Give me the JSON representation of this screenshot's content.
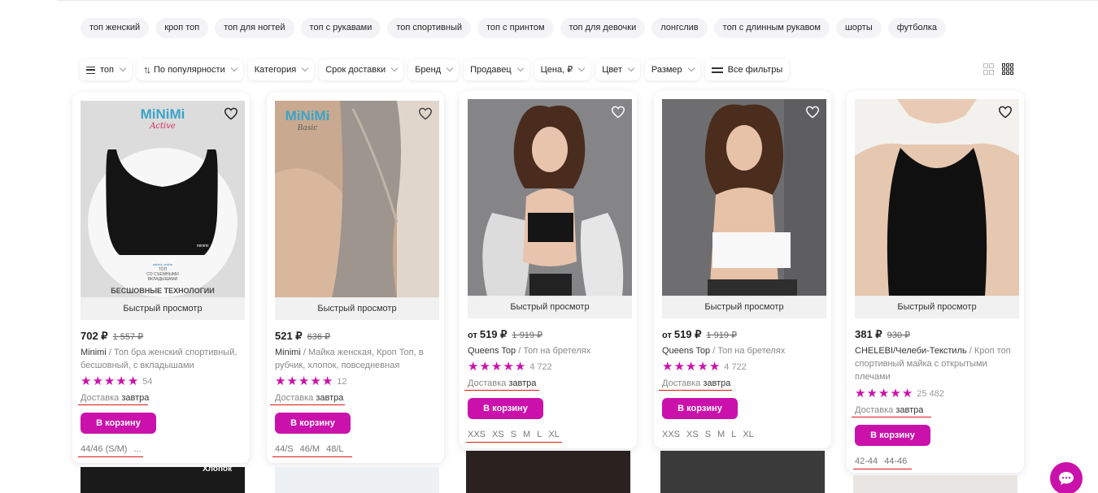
{
  "chips": [
    "топ женский",
    "кроп топ",
    "топ для ногтей",
    "топ с рукавами",
    "топ спортивный",
    "топ с принтом",
    "топ для девочки",
    "лонгслив",
    "топ с длинным рукавом",
    "шорты",
    "футболка"
  ],
  "filters": {
    "category_path": "топ",
    "sort": "По популярности",
    "items": [
      "Категория",
      "Срок доставки",
      "Бренд",
      "Продавец",
      "Цена, ₽",
      "Цвет",
      "Размер"
    ],
    "all_filters": "Все фильтры"
  },
  "common": {
    "quick_view": "Быстрый просмотр",
    "add_to_cart": "В корзину",
    "delivery_label": "Доставка",
    "delivery_value": "завтра",
    "from": "от",
    "sep": "/"
  },
  "products": [
    {
      "price": "702 ₽",
      "old_price": "1 557 ₽",
      "from": false,
      "brand": "Minimi",
      "name": "Топ бра женский спортивный, бесшовный, с вкладышами",
      "rating_count": "54",
      "sizes": [
        "44/46 (S/M)",
        "..."
      ],
      "image_text": {
        "logo": "MiNiMi",
        "sub": "Active",
        "label": "БЕСШОВНЫЕ ТЕХНОЛОГИИ",
        "tag_line1": "minimi_active",
        "tag_line2": "ТОП",
        "tag_line3": "СО СЪЕМНЫМИ",
        "tag_line4": "ВКЛАДЫШАМИ",
        "tag": "minimi"
      }
    },
    {
      "price": "521 ₽",
      "old_price": "636 ₽",
      "from": false,
      "brand": "Minimi",
      "name": "Майка женская, Кроп Топ, в рубчик, хлопок, повседневная",
      "rating_count": "12",
      "sizes": [
        "44/S",
        "46/M",
        "48/L"
      ],
      "image_text": {
        "logo": "MiNiMi",
        "sub": "Basic"
      }
    },
    {
      "price": "519 ₽",
      "old_price": "1 919 ₽",
      "from": true,
      "brand": "Queens Top",
      "name": "Топ на бретелях",
      "rating_count": "4 722",
      "sizes": [
        "XXS",
        "XS",
        "S",
        "M",
        "L",
        "XL"
      ]
    },
    {
      "price": "519 ₽",
      "old_price": "1 919 ₽",
      "from": true,
      "brand": "Queens Top",
      "name": "Топ на бретелях",
      "rating_count": "4 722",
      "sizes": [
        "XXS",
        "XS",
        "S",
        "M",
        "L",
        "XL"
      ]
    },
    {
      "price": "381 ₽",
      "old_price": "930 ₽",
      "from": false,
      "brand": "CHELEBI/Челеби-Текстиль",
      "name": "Кроп топ спортивный майка с открытыми плечами",
      "rating_count": "25 482",
      "sizes": [
        "42-44",
        "44-46"
      ]
    }
  ],
  "next_row": {
    "first_caption": "Хлопок"
  },
  "colors": {
    "accent": "#cb11ab",
    "underline": "#d91a1a"
  }
}
